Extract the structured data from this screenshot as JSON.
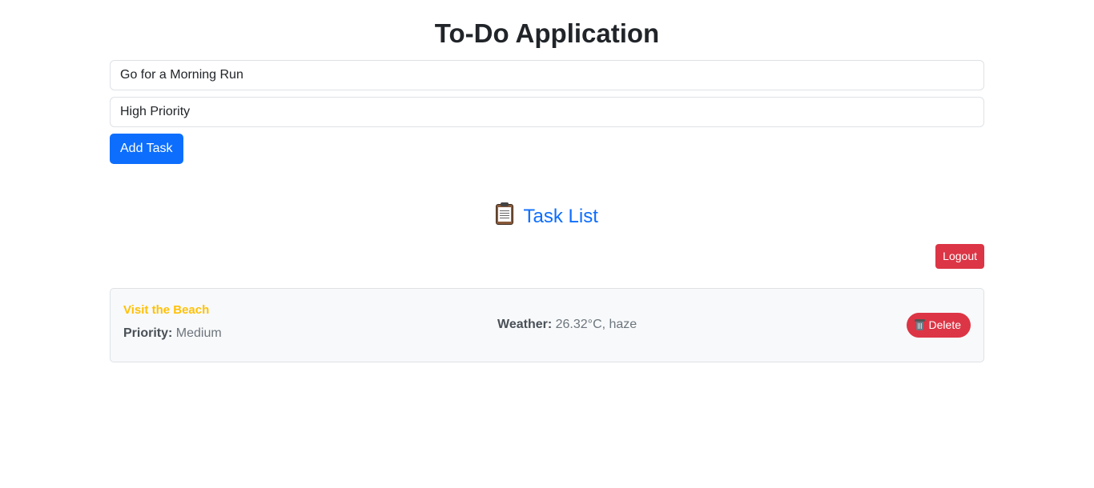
{
  "app": {
    "title": "To-Do Application"
  },
  "form": {
    "task_value": "Go for a Morning Run",
    "priority_value": "High Priority",
    "add_button_label": "Add Task"
  },
  "task_list": {
    "icon": "clipboard-icon",
    "title": "Task List",
    "logout_label": "Logout",
    "items": [
      {
        "name": "Visit the Beach",
        "priority_label": "Priority:",
        "priority": "Medium",
        "weather_label": "Weather:",
        "weather": "26.32°C, haze",
        "delete_icon": "trash-icon",
        "delete_label": "Delete"
      }
    ]
  },
  "colors": {
    "primary": "#0d6efd",
    "danger": "#dc3545",
    "warning": "#ffc107",
    "card_bg": "#f8f9fa"
  }
}
